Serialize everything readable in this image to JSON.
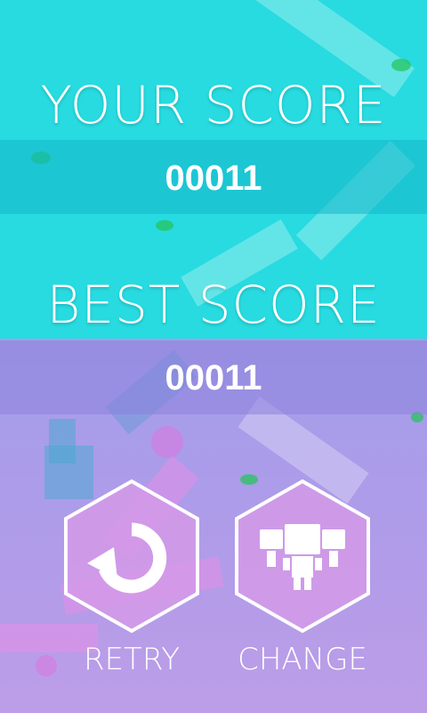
{
  "game_over": {
    "your_score_title": "YOUR SCORE",
    "your_score_value": "00011",
    "best_score_title": "BEST SCORE",
    "best_score_value": "00011"
  },
  "buttons": {
    "retry": {
      "label": "RETRY",
      "icon": "retry-icon"
    },
    "change": {
      "label": "CHANGE",
      "icon": "character-select-icon"
    }
  },
  "colors": {
    "top_bg": "#27dbe0",
    "bottom_bg": "#a79be8",
    "hex_fill": "#d49ae8",
    "text": "#ffffff"
  }
}
